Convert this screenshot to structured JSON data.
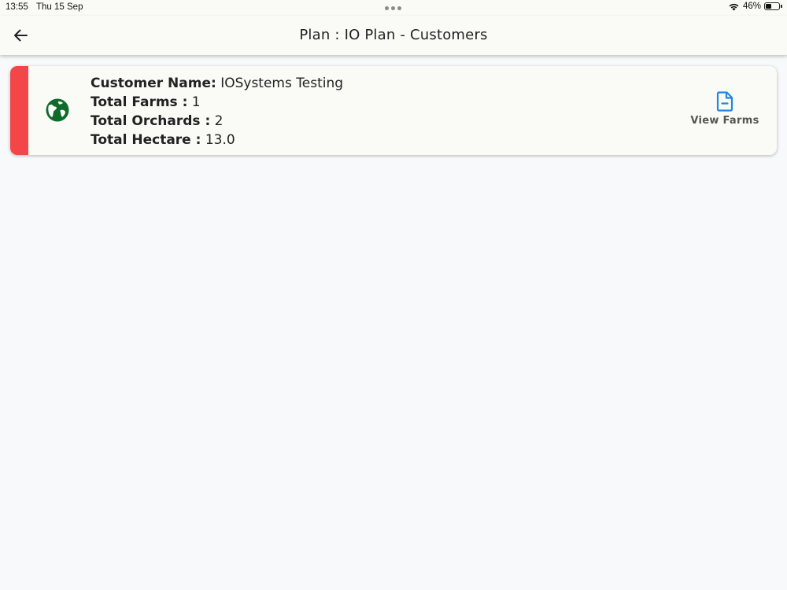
{
  "status_bar": {
    "time": "13:55",
    "date": "Thu 15 Sep",
    "battery_percent": "46%",
    "battery_level": 0.46
  },
  "app_bar": {
    "title": "Plan : IO Plan - Customers",
    "back_icon": "arrow-left-icon"
  },
  "customer_card": {
    "accent_color": "#f44549",
    "icon": "globe-icon",
    "icon_color": "#0f6b2a",
    "customer_name_label": "Customer Name:",
    "customer_name_value": "IOSystems Testing",
    "total_farms_label": "Total Farms :",
    "total_farms_value": "1",
    "total_orchards_label": "Total Orchards :",
    "total_orchards_value": "2",
    "total_hectare_label": "Total Hectare :",
    "total_hectare_value": "13.0",
    "view_farms_label": "View Farms",
    "view_farms_icon": "document-icon",
    "view_farms_icon_color": "#1e88e5"
  }
}
